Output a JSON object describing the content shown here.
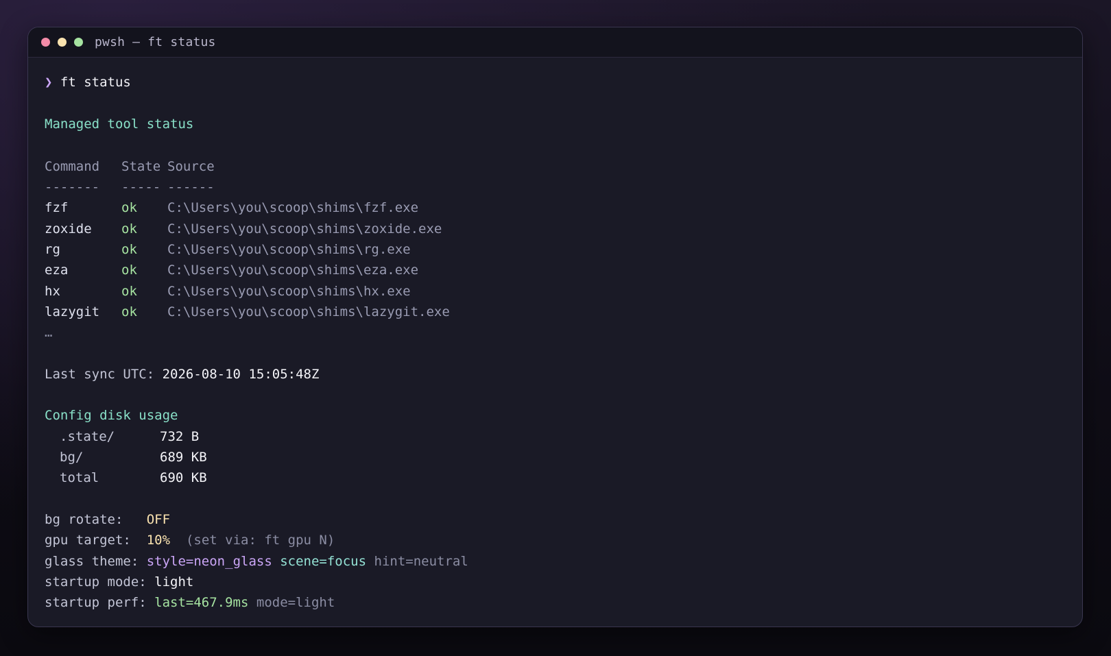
{
  "window": {
    "title": "pwsh — ft status"
  },
  "prompt": {
    "symbol": "❯",
    "command": "ft status"
  },
  "managed": {
    "heading": "Managed tool status",
    "columns": [
      "Command",
      "State",
      "Source"
    ],
    "separators": [
      "-------",
      "-----",
      "------"
    ],
    "rows": [
      {
        "command": "fzf",
        "state": "ok",
        "source": "C:\\Users\\you\\scoop\\shims\\fzf.exe"
      },
      {
        "command": "zoxide",
        "state": "ok",
        "source": "C:\\Users\\you\\scoop\\shims\\zoxide.exe"
      },
      {
        "command": "rg",
        "state": "ok",
        "source": "C:\\Users\\you\\scoop\\shims\\rg.exe"
      },
      {
        "command": "eza",
        "state": "ok",
        "source": "C:\\Users\\you\\scoop\\shims\\eza.exe"
      },
      {
        "command": "hx",
        "state": "ok",
        "source": "C:\\Users\\you\\scoop\\shims\\hx.exe"
      },
      {
        "command": "lazygit",
        "state": "ok",
        "source": "C:\\Users\\you\\scoop\\shims\\lazygit.exe"
      }
    ],
    "ellipsis": "…"
  },
  "sync": {
    "label": "Last sync UTC:",
    "value": "2026-08-10 15:05:48Z"
  },
  "disk": {
    "heading": "Config disk usage",
    "items": [
      {
        "name": ".state/",
        "size": "732 B"
      },
      {
        "name": "bg/",
        "size": "689 KB"
      },
      {
        "name": "total",
        "size": "690 KB"
      }
    ]
  },
  "settings": {
    "bg_rotate_label": "bg rotate:",
    "bg_rotate_value": "OFF",
    "gpu_label": "gpu target:",
    "gpu_value": "10%",
    "gpu_hint": "(set via: ft gpu N)",
    "glass_label": "glass theme:",
    "glass_style": "style=neon_glass",
    "glass_scene": "scene=focus",
    "glass_hint": "hint=neutral",
    "startup_mode_label": "startup mode:",
    "startup_mode_value": "light",
    "startup_perf_label": "startup perf:",
    "startup_perf_last": "last=467.9ms",
    "startup_perf_mode": "mode=light"
  },
  "colors": {
    "accent_purple": "#cba6f7",
    "ok_green": "#a6e3a1",
    "section_teal": "#89e0c8",
    "warn_yellow": "#f9e2af"
  }
}
